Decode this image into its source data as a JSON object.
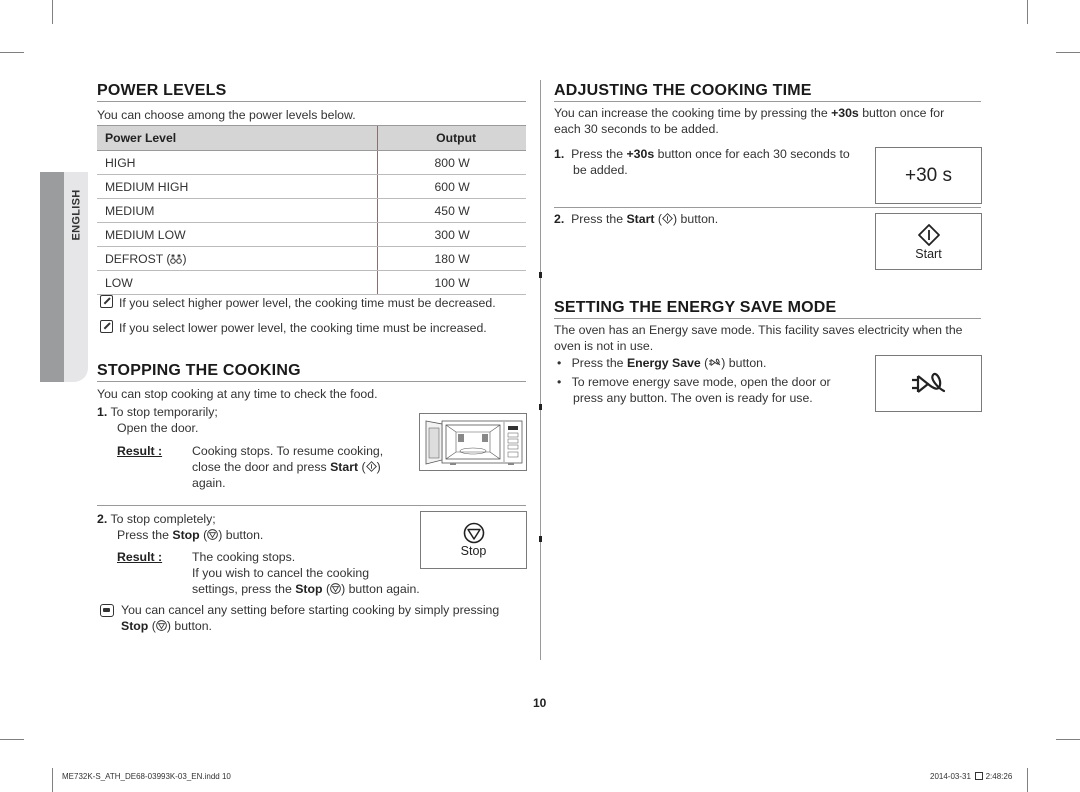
{
  "side_tab": {
    "label": "ENGLISH"
  },
  "power_levels": {
    "title": "POWER LEVELS",
    "intro": "You can choose among the power levels below.",
    "table": {
      "headers": [
        "Power Level",
        "Output"
      ],
      "rows": [
        {
          "level": "HIGH",
          "output": "800 W"
        },
        {
          "level": "MEDIUM HIGH",
          "output": "600 W"
        },
        {
          "level": "MEDIUM",
          "output": "450 W"
        },
        {
          "level": "MEDIUM LOW",
          "output": "300 W"
        },
        {
          "level": "DEFROST",
          "icon": "defrost-icon",
          "output": "180 W"
        },
        {
          "level": "LOW",
          "output": "100 W"
        }
      ]
    },
    "notes": [
      "If you select higher power level, the cooking time must be decreased.",
      "If you select lower power level, the cooking time must be increased."
    ]
  },
  "stopping": {
    "title": "STOPPING THE COOKING",
    "intro": "You can stop cooking at any time to check the food.",
    "step1": {
      "num": "1.",
      "line1": "To stop temporarily;",
      "line2": "Open the door.",
      "result_label": "Result :",
      "result_line1": "Cooking stops. To resume cooking,",
      "result_line2a": "close the door and press ",
      "result_bold": "Start",
      "result_line3": "again."
    },
    "step2": {
      "num": "2.",
      "line1": "To stop completely;",
      "line2a": "Press the ",
      "line2_bold": "Stop",
      "line2b": " button.",
      "result_label": "Result :",
      "result_line1": "The cooking stops.",
      "result_line2": "If you wish to cancel the cooking",
      "result_line3a": "settings, press the ",
      "result_bold": "Stop",
      "result_line3b": " button again."
    },
    "stop_button_label": "Stop",
    "tip_line1": "You can cancel any setting before starting cooking by simply pressing",
    "tip_bold": "Stop",
    "tip_line2b": " button."
  },
  "adjusting": {
    "title": "ADJUSTING THE COOKING TIME",
    "intro_a": "You can increase the cooking time by pressing the ",
    "intro_bold": "+30s",
    "intro_b": " button once for",
    "intro_line2": "each 30 seconds to be added.",
    "step1": {
      "num": "1.",
      "a": "Press the ",
      "bold": "+30s",
      "b": " button once for each 30 seconds to",
      "line2": "be added."
    },
    "plus30_label": "+30 s",
    "step2": {
      "num": "2.",
      "a": "Press the ",
      "bold": "Start",
      "b": " button."
    },
    "start_label": "Start"
  },
  "energy": {
    "title": "SETTING THE ENERGY SAVE MODE",
    "intro_line1": "The oven has an Energy save mode. This facility saves electricity when the",
    "intro_line2": "oven is not in use.",
    "bullets": [
      {
        "a": "Press the ",
        "bold": "Energy Save",
        "b": " button."
      },
      {
        "line1": "To remove energy save mode, open the door or",
        "line2": "press any button. The oven is ready for use."
      }
    ]
  },
  "page_number": "10",
  "footer": {
    "file": "ME732K-S_ATH_DE68-03993K-03_EN.indd   10",
    "date": "2014-03-31",
    "time": "2:48:26"
  }
}
